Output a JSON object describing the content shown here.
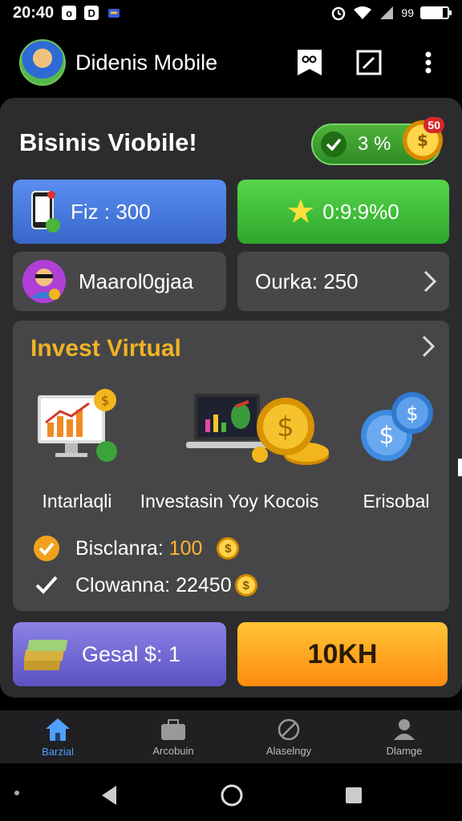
{
  "status": {
    "time": "20:40",
    "icon1": "o",
    "icon2": "D",
    "signal_text": "99"
  },
  "app_bar": {
    "title": "Didenis Mobile"
  },
  "header": {
    "title": "Bisinis Viobile!",
    "progress": "3 %",
    "coin_badge": "50"
  },
  "tiles": {
    "fiz": "Fiz : 300",
    "timer": "0:9:9%0",
    "user": "Maarol0gjaa",
    "ourka": "Ourka: 250"
  },
  "invest": {
    "title": "Invest Virtual",
    "items": [
      {
        "label": "Intarlaqli",
        "icon": "monitor-chart-icon"
      },
      {
        "label": "Investasin Yoy Kocois",
        "icon": "laptop-chart-icon"
      },
      {
        "label": "Erisobal",
        "icon": "blue-coins-icon"
      }
    ],
    "balances": [
      {
        "label": "Bisclanra:",
        "value": "100"
      },
      {
        "label": "Clowanna:",
        "value": "22450"
      }
    ]
  },
  "buttons": {
    "gesal": "Gesal $: 1",
    "action": "10KH"
  },
  "bottom_nav": [
    {
      "label": "Barzial",
      "icon": "home-icon",
      "active": true
    },
    {
      "label": "Arcobuin",
      "icon": "briefcase-icon",
      "active": false
    },
    {
      "label": "Alaselngy",
      "icon": "globe-icon",
      "active": false
    },
    {
      "label": "Dlamge",
      "icon": "person-icon",
      "active": false
    }
  ],
  "colors": {
    "accent_orange": "#f0b325",
    "green": "#2ea72c",
    "blue": "#3767c9",
    "purple": "#6b62d2"
  }
}
